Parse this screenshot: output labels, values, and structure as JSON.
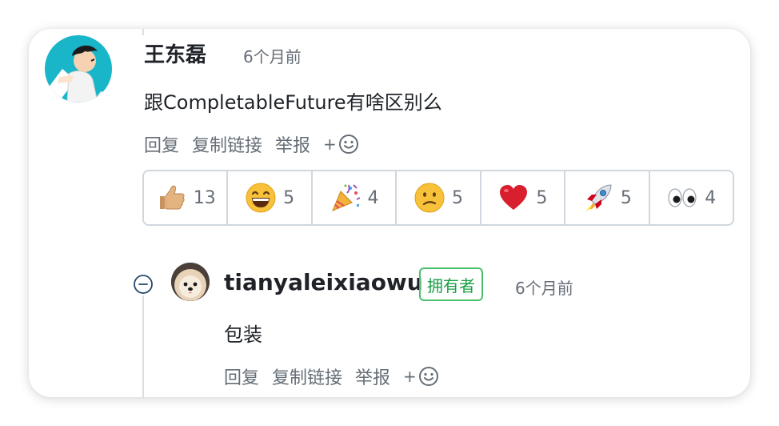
{
  "comment": {
    "author": "王东磊",
    "time": "6个月前",
    "body": "跟CompletableFuture有啥区别么",
    "actions": {
      "reply": "回复",
      "copy_link": "复制链接",
      "report": "举报",
      "add_reaction": "+"
    },
    "reactions": [
      {
        "icon": "thumbs-up-icon",
        "count": "13"
      },
      {
        "icon": "grinning-face-icon",
        "count": "5"
      },
      {
        "icon": "party-popper-icon",
        "count": "4"
      },
      {
        "icon": "confused-face-icon",
        "count": "5"
      },
      {
        "icon": "heart-icon",
        "count": "5"
      },
      {
        "icon": "rocket-icon",
        "count": "5"
      },
      {
        "icon": "eyes-icon",
        "count": "4"
      }
    ]
  },
  "reply": {
    "author": "tianyaleixiaowu",
    "badge": "拥有者",
    "time": "6个月前",
    "body": "包装",
    "actions": {
      "reply": "回复",
      "copy_link": "复制链接",
      "report": "举报",
      "add_reaction": "+"
    }
  },
  "colors": {
    "badge_green": "#1a9f43",
    "avatar_teal": "#19b5c8",
    "muted_text": "#656d76"
  }
}
